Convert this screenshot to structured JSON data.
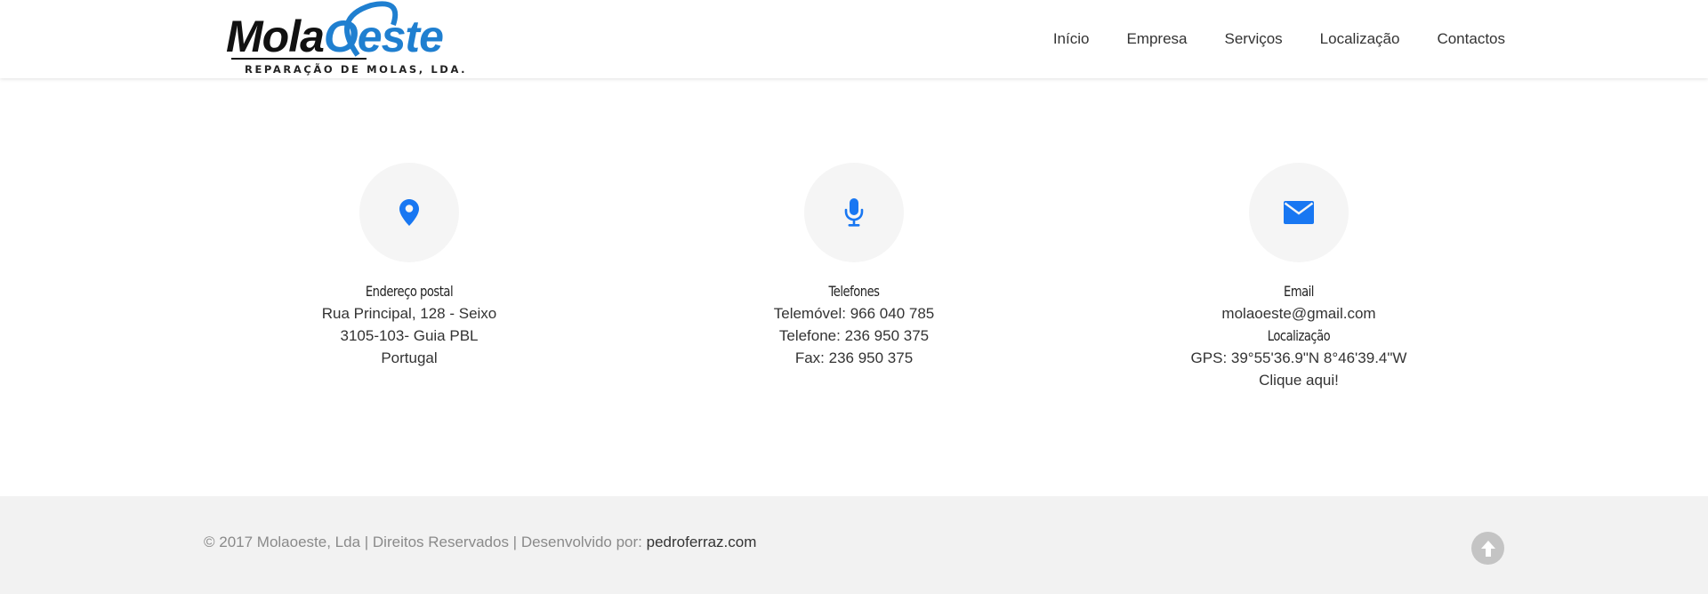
{
  "header": {
    "logo": {
      "word_part_1": "Mola",
      "word_part_2": "Oeste",
      "tagline": "REPARAÇÃO DE MOLAS, LDA."
    },
    "nav": [
      {
        "label": "Início"
      },
      {
        "label": "Empresa"
      },
      {
        "label": "Serviços"
      },
      {
        "label": "Localização"
      },
      {
        "label": "Contactos"
      }
    ]
  },
  "contacts": {
    "address": {
      "icon": "map-marker-icon",
      "title": "Endereço postal",
      "lines": [
        "Rua Principal, 128 - Seixo",
        "3105-103- Guia PBL",
        "Portugal"
      ]
    },
    "phones": {
      "icon": "microphone-icon",
      "title": "Telefones",
      "lines": [
        "Telemóvel: 966 040 785",
        "Telefone: 236 950 375",
        "Fax: 236 950 375"
      ]
    },
    "email": {
      "icon": "envelope-icon",
      "title": "Email",
      "address": "molaoeste@gmail.com",
      "location_title": "Localização",
      "gps": "GPS: 39°55'36.9\"N 8°46'39.4\"W",
      "map_link": "Clique aqui!"
    }
  },
  "footer": {
    "copyright": "© 2017 Molaoeste, Lda | Direitos Reservados | Desenvolvido por: ",
    "developer_link": "pedroferraz.com",
    "top_button_icon": "arrow-up-icon"
  },
  "colors": {
    "accent": "#1877f2",
    "logo_blue": "#1f7fd0",
    "footer_bg": "#f2f2f2",
    "icon_circle_bg": "#f5f5f5"
  }
}
